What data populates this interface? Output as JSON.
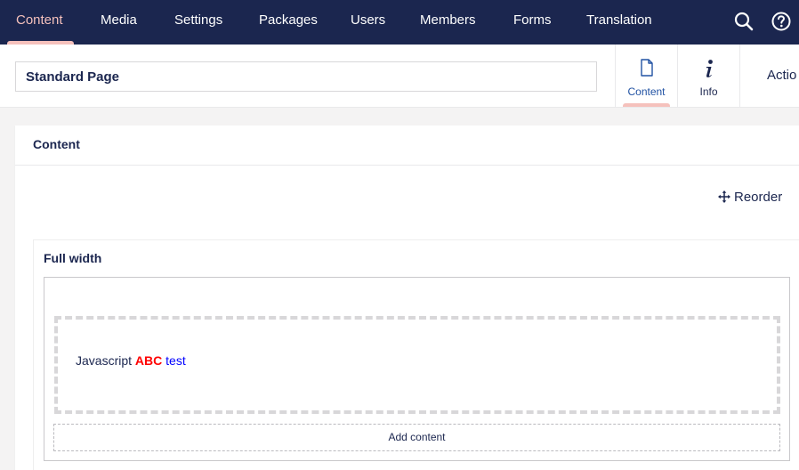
{
  "nav": {
    "items": [
      {
        "label": "Content"
      },
      {
        "label": "Media"
      },
      {
        "label": "Settings"
      },
      {
        "label": "Packages"
      },
      {
        "label": "Users"
      },
      {
        "label": "Members"
      },
      {
        "label": "Forms"
      },
      {
        "label": "Translation"
      }
    ],
    "search_icon": "search-icon",
    "help_icon": "help-icon",
    "colors": {
      "background": "#1b264f",
      "active": "#f5c1bc",
      "text": "#ffffff"
    }
  },
  "editor": {
    "name_value": "Standard Page",
    "apps": [
      {
        "label": "Content",
        "icon": "document-icon"
      },
      {
        "label": "Info",
        "icon": "info-icon"
      }
    ],
    "actions_label": "Actio"
  },
  "content_panel": {
    "title": "Content",
    "reorder_label": "Reorder",
    "row": {
      "title": "Full width",
      "control_text": {
        "part1": "Javascript",
        "part2": "ABC",
        "part3": "test"
      },
      "add_content_label": "Add content"
    }
  }
}
